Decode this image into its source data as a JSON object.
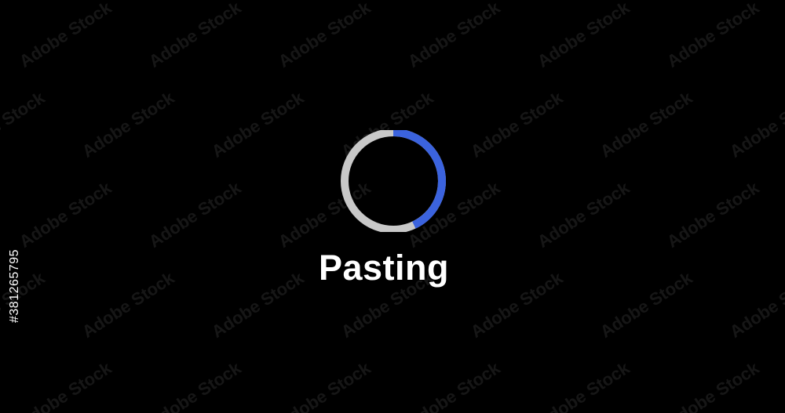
{
  "status": {
    "label": "Pasting",
    "progress_fraction": 0.43
  },
  "colors": {
    "background": "#000000",
    "ring_track": "#c8c8c8",
    "ring_progress": "#3b63de",
    "label": "#ffffff"
  },
  "watermark": {
    "text": "Adobe Stock"
  },
  "stock_id": "#381265795"
}
